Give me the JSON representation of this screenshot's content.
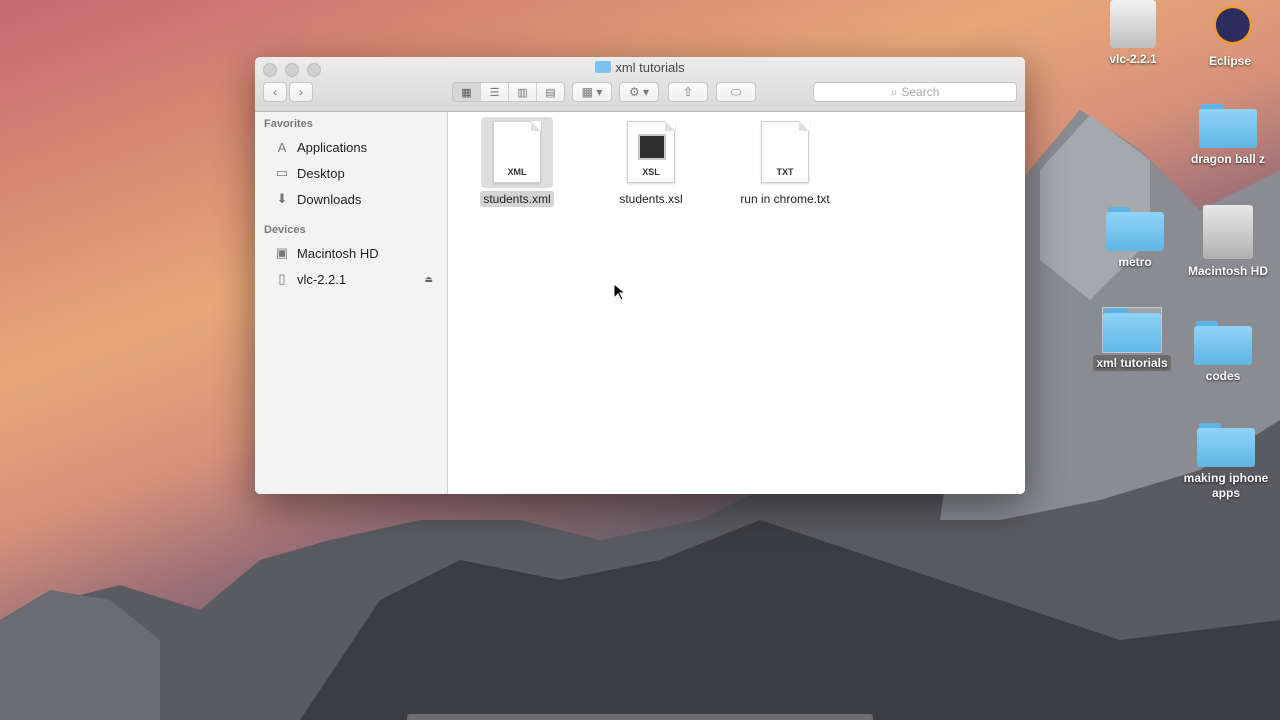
{
  "window": {
    "title": "xml tutorials",
    "search_placeholder": "Search"
  },
  "sidebar": {
    "favorites_header": "Favorites",
    "favorites": [
      {
        "label": "Applications",
        "icon": "applications-icon"
      },
      {
        "label": "Desktop",
        "icon": "desktop-icon"
      },
      {
        "label": "Downloads",
        "icon": "downloads-icon"
      }
    ],
    "devices_header": "Devices",
    "devices": [
      {
        "label": "Macintosh HD",
        "icon": "hard-drive-icon"
      },
      {
        "label": "vlc-2.2.1",
        "icon": "disk-image-icon",
        "eject": "⏏"
      }
    ]
  },
  "files": [
    {
      "name": "students.xml",
      "tag": "XML",
      "selected": true
    },
    {
      "name": "students.xsl",
      "tag": "XSL",
      "selected": false
    },
    {
      "name": "run in chrome.txt",
      "tag": "TXT",
      "selected": false
    }
  ],
  "desktop": {
    "items": [
      {
        "label": "vlc-2.2.1"
      },
      {
        "label": "Eclipse"
      },
      {
        "label": "dragon ball z"
      },
      {
        "label": "metro"
      },
      {
        "label": "Macintosh HD"
      },
      {
        "label": "xml tutorials",
        "selected": true
      },
      {
        "label": "codes"
      },
      {
        "label": "making iphone apps"
      }
    ]
  },
  "colors": {
    "folder_blue": "#6cc0ee",
    "selection_gray": "#d4d4d4"
  }
}
